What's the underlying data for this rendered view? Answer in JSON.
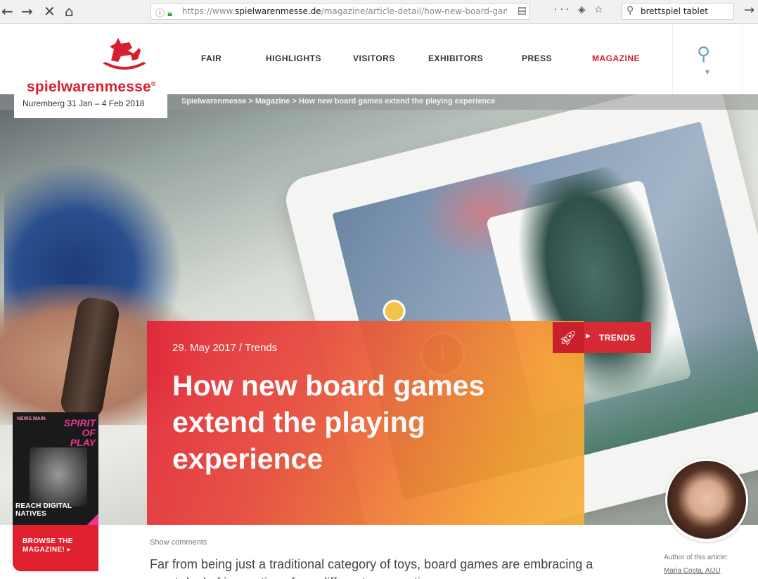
{
  "browser": {
    "nav_back": "←",
    "nav_forward": "→",
    "nav_stop": "✕",
    "nav_home": "⌂",
    "url_prefix": "https://www.",
    "url_domain": "spielwarenmesse.de",
    "url_path": "/magazine/article-detail/how-new-board-game",
    "search_query": "brettspiel tablet",
    "go_arrow": "→"
  },
  "header": {
    "logo_name": "spielwarenmesse",
    "logo_reg": "®",
    "logo_dates": "Nuremberg 31 Jan – 4 Feb 2018",
    "nav": [
      "FAIR",
      "HIGHLIGHTS",
      "VISITORS",
      "EXHIBITORS",
      "PRESS",
      "MAGAZINE"
    ],
    "active_nav": "MAGAZINE",
    "accent_color": "#d61f2f"
  },
  "breadcrumb": "Spielwarenmesse > Magazine > How new board games extend the playing experience",
  "hero": {
    "date_line": "29. May 2017 / Trends",
    "headline": "How new board games extend the playing experience",
    "tag_label": "TRENDS",
    "tag_icon": "rocket-icon",
    "app_info_glyph": "i"
  },
  "promo": {
    "cover_title": "SPIRIT OF PLAY",
    "cover_teaser": "NEWS MAIN",
    "cover_cta": "REACH DIGITAL NATIVES",
    "browse_label": "BROWSE THE MAGAZINE! ▸"
  },
  "article": {
    "show_comments": "Show comments",
    "lead": "Far from being just a traditional category of toys, board games are embracing a great deal of innovations from different perspectives",
    "author_label": "Author of this article:",
    "author_name": "Maria Costa, AIJU"
  }
}
